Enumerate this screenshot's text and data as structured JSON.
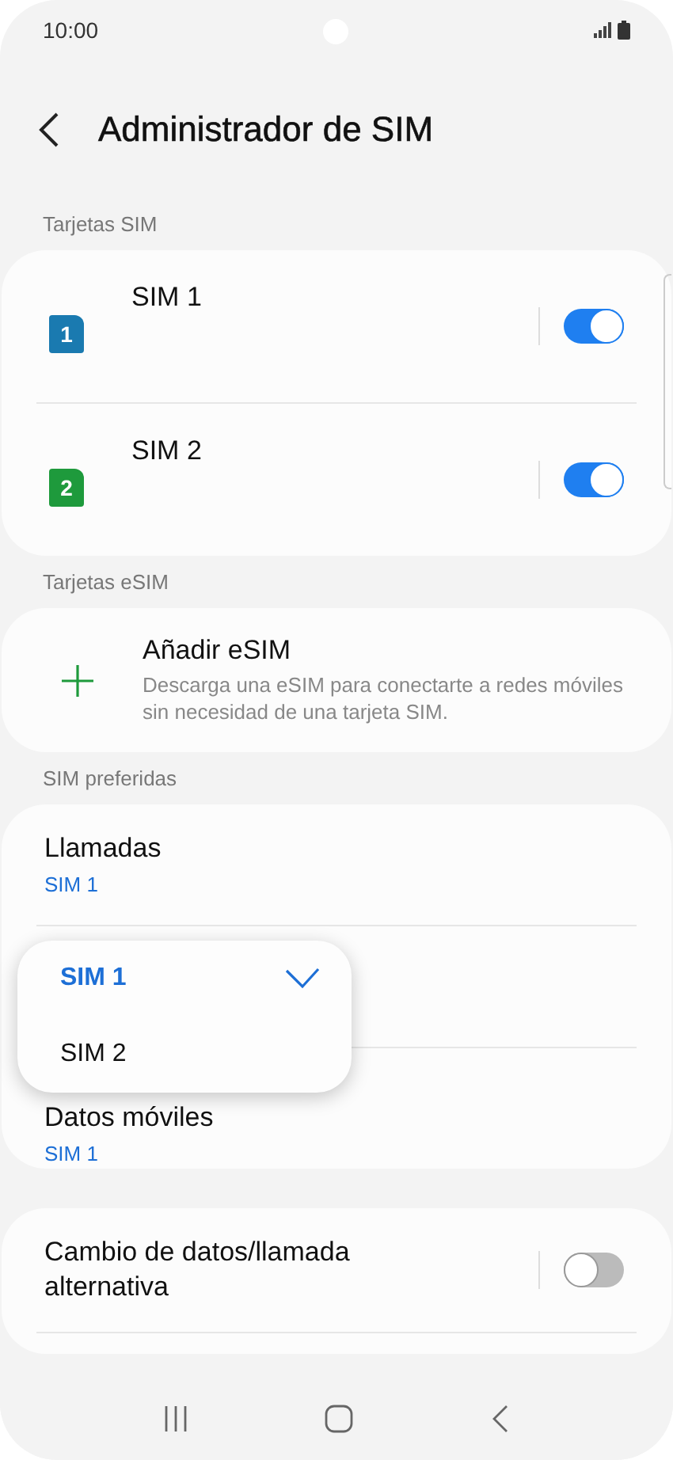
{
  "status_bar": {
    "time": "10:00"
  },
  "header": {
    "title": "Administrador de SIM"
  },
  "sim_section": {
    "label": "Tarjetas SIM",
    "cards": [
      {
        "badge": "1",
        "name": "SIM 1",
        "color": "#1a7ab0",
        "on": true
      },
      {
        "badge": "2",
        "name": "SIM 2",
        "color": "#1e9a3c",
        "on": true
      }
    ]
  },
  "esim_section": {
    "label": "Tarjetas eSIM",
    "add": {
      "title": "Añadir eSIM",
      "description": "Descarga una eSIM para conectarte a redes móviles sin necesidad de una tarjeta SIM."
    }
  },
  "preferred_section": {
    "label": "SIM preferidas",
    "rows": [
      {
        "kind": "setting",
        "title": "Llamadas",
        "value": "SIM 1"
      },
      {
        "kind": "covered"
      },
      {
        "kind": "setting",
        "title": "Datos móviles",
        "value": "SIM 1"
      }
    ]
  },
  "dropdown": {
    "options": [
      {
        "label": "SIM 1",
        "selected": true
      },
      {
        "label": "SIM 2",
        "selected": false
      }
    ]
  },
  "switch_row": {
    "title": "Cambio de datos/llamada alternativa",
    "on": false
  }
}
